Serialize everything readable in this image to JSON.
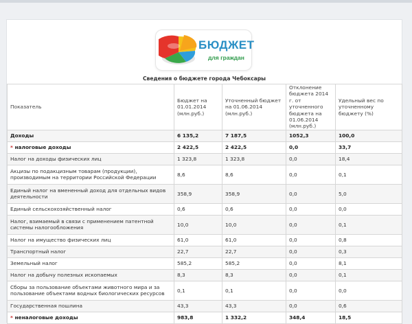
{
  "logo": {
    "title": "БЮДЖЕТ",
    "subtitle": "для граждан"
  },
  "caption": "Сведения о бюджете города Чебоксары",
  "columns": [
    "Показатель",
    "Бюджет на 01.01.2014 (млн.руб.)",
    "Уточненный бюджет на 01.06.2014 (млн.руб.)",
    "Отклонение бюджета 2014 г. от уточненного бюджета на 01.06.2014 (млн.руб.)",
    "Удельный вес по уточненному бюджету (%)"
  ],
  "rows": [
    {
      "star": "",
      "name": "Доходы",
      "b": "6 135,2",
      "u": "7 187,5",
      "d": "1052,3",
      "w": "100,0",
      "bold": true
    },
    {
      "star": "*",
      "name": " налоговые доходы",
      "b": "2 422,5",
      "u": "2 422,5",
      "d": "0,0",
      "w": "33,7",
      "bold": true
    },
    {
      "star": "",
      "name": "Налог на доходы физических лиц",
      "b": "1 323,8",
      "u": "1 323,8",
      "d": "0,0",
      "w": "18,4",
      "bold": false
    },
    {
      "star": "",
      "name": "Акцизы по подакцизным товарам (продукции), производимым на территории Российской Федерации",
      "b": "8,6",
      "u": "8,6",
      "d": "0,0",
      "w": "0,1",
      "bold": false
    },
    {
      "star": "",
      "name": "Единый налог на вмененный доход для отдельных видов деятельности",
      "b": "358,9",
      "u": "358,9",
      "d": "0,0",
      "w": "5,0",
      "bold": false
    },
    {
      "star": "",
      "name": "Единый сельскохозяйственный налог",
      "b": "0,6",
      "u": "0,6",
      "d": "0,0",
      "w": "0,0",
      "bold": false
    },
    {
      "star": "",
      "name": "Налог, взимаемый в связи с применением патентной системы налогообложения",
      "b": "10,0",
      "u": "10,0",
      "d": "0,0",
      "w": "0,1",
      "bold": false
    },
    {
      "star": "",
      "name": "Налог на имущество физических лиц",
      "b": "61,0",
      "u": "61,0",
      "d": "0,0",
      "w": "0,8",
      "bold": false
    },
    {
      "star": "",
      "name": "Транспортный налог",
      "b": "22,7",
      "u": "22,7",
      "d": "0,0",
      "w": "0,3",
      "bold": false
    },
    {
      "star": "",
      "name": "Земельный налог",
      "b": "585,2",
      "u": "585,2",
      "d": "0,0",
      "w": "8,1",
      "bold": false
    },
    {
      "star": "",
      "name": "Налог на добычу полезных ископаемых",
      "b": "8,3",
      "u": "8,3",
      "d": "0,0",
      "w": "0,1",
      "bold": false
    },
    {
      "star": "",
      "name": "Сборы за пользование объектами животного мира и за пользование объектами водных биологических ресурсов",
      "b": "0,1",
      "u": "0,1",
      "d": "0,0",
      "w": "0,0",
      "bold": false
    },
    {
      "star": "",
      "name": "Государственная пошлина",
      "b": "43,3",
      "u": "43,3",
      "d": "0,0",
      "w": "0,6",
      "bold": false
    },
    {
      "star": "*",
      "name": " неналоговые доходы",
      "b": "983,8",
      "u": "1 332,2",
      "d": "348,4",
      "w": "18,5",
      "bold": true
    }
  ]
}
